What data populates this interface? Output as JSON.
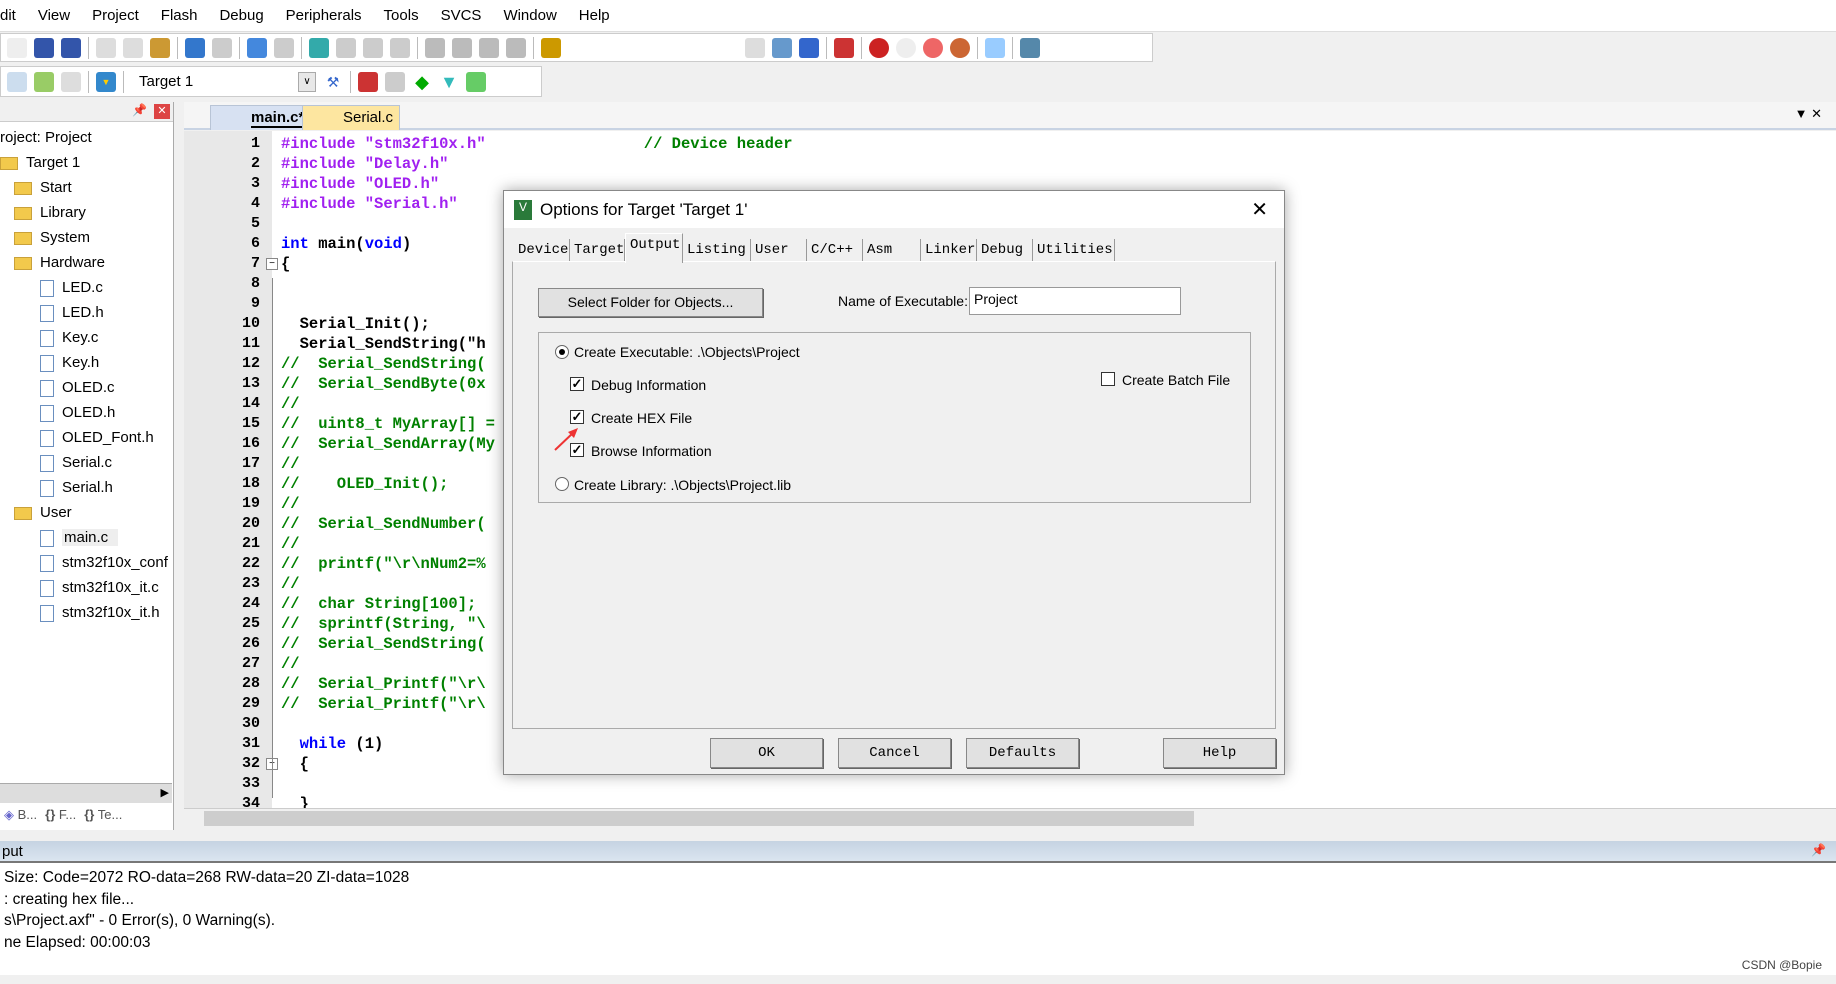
{
  "menu": [
    "dit",
    "View",
    "Project",
    "Flash",
    "Debug",
    "Peripherals",
    "Tools",
    "SVCS",
    "Window",
    "Help"
  ],
  "toolbar": {
    "target_select": "Target 1"
  },
  "file_tabs": [
    {
      "label": "main.c*",
      "active": true
    },
    {
      "label": "Serial.c",
      "active": false
    }
  ],
  "project_panel": {
    "items": [
      {
        "label": "roject: Project",
        "depth": 0,
        "icon": "none"
      },
      {
        "label": "Target 1",
        "depth": 0,
        "icon": "folder-open-icon"
      },
      {
        "label": "Start",
        "depth": 1,
        "icon": "folder-icon"
      },
      {
        "label": "Library",
        "depth": 1,
        "icon": "folder-icon"
      },
      {
        "label": "System",
        "depth": 1,
        "icon": "folder-icon"
      },
      {
        "label": "Hardware",
        "depth": 1,
        "icon": "folder-open-icon"
      },
      {
        "label": "LED.c",
        "depth": 2,
        "icon": "file-icon"
      },
      {
        "label": "LED.h",
        "depth": 2,
        "icon": "file-icon"
      },
      {
        "label": "Key.c",
        "depth": 2,
        "icon": "file-icon"
      },
      {
        "label": "Key.h",
        "depth": 2,
        "icon": "file-icon"
      },
      {
        "label": "OLED.c",
        "depth": 2,
        "icon": "file-icon"
      },
      {
        "label": "OLED.h",
        "depth": 2,
        "icon": "file-icon"
      },
      {
        "label": "OLED_Font.h",
        "depth": 2,
        "icon": "file-icon"
      },
      {
        "label": "Serial.c",
        "depth": 2,
        "icon": "file-icon"
      },
      {
        "label": "Serial.h",
        "depth": 2,
        "icon": "file-icon"
      },
      {
        "label": "User",
        "depth": 1,
        "icon": "folder-open-icon"
      },
      {
        "label": "main.c",
        "depth": 2,
        "icon": "file-icon",
        "selected": true
      },
      {
        "label": "stm32f10x_conf",
        "depth": 2,
        "icon": "file-icon"
      },
      {
        "label": "stm32f10x_it.c",
        "depth": 2,
        "icon": "file-icon"
      },
      {
        "label": "stm32f10x_it.h",
        "depth": 2,
        "icon": "file-icon"
      }
    ],
    "bottom_tabs": [
      "B...",
      "F...",
      "Te..."
    ]
  },
  "code_colors": {
    "pp": "#a020f0",
    "str": "#a020f0",
    "kw": "#0000ff",
    "cm": "#008000",
    "tx": "#000000"
  },
  "code": [
    [
      [
        "#include ",
        "pp"
      ],
      [
        "\"stm32f10x.h\"",
        "str"
      ],
      [
        "                 // Device header",
        "cm"
      ]
    ],
    [
      [
        "#include ",
        "pp"
      ],
      [
        "\"Delay.h\"",
        "str"
      ]
    ],
    [
      [
        "#include ",
        "pp"
      ],
      [
        "\"OLED.h\"",
        "str"
      ]
    ],
    [
      [
        "#include ",
        "pp"
      ],
      [
        "\"Serial.h\"",
        "str"
      ]
    ],
    [],
    [
      [
        "int",
        "kw"
      ],
      [
        " main(",
        "tx"
      ],
      [
        "void",
        "kw"
      ],
      [
        ")",
        "tx"
      ]
    ],
    [
      [
        "{",
        "tx"
      ]
    ],
    [],
    [],
    [
      [
        "  Serial_Init();",
        "tx"
      ]
    ],
    [
      [
        "  Serial_SendString(\"h",
        "tx"
      ]
    ],
    [
      [
        "//  Serial_SendString(",
        "cm"
      ]
    ],
    [
      [
        "//  Serial_SendByte(0x",
        "cm"
      ]
    ],
    [
      [
        "//",
        "cm"
      ]
    ],
    [
      [
        "//  uint8_t MyArray[] =",
        "cm"
      ]
    ],
    [
      [
        "//  Serial_SendArray(My",
        "cm"
      ]
    ],
    [
      [
        "//",
        "cm"
      ]
    ],
    [
      [
        "//    OLED_Init();",
        "cm"
      ]
    ],
    [
      [
        "//",
        "cm"
      ]
    ],
    [
      [
        "//  Serial_SendNumber(",
        "cm"
      ]
    ],
    [
      [
        "//",
        "cm"
      ]
    ],
    [
      [
        "//  printf(\"\\r\\nNum2=%",
        "cm"
      ]
    ],
    [
      [
        "//",
        "cm"
      ]
    ],
    [
      [
        "//  char String[100];",
        "cm"
      ]
    ],
    [
      [
        "//  sprintf(String, \"\\",
        "cm"
      ]
    ],
    [
      [
        "//  Serial_SendString(",
        "cm"
      ]
    ],
    [
      [
        "//",
        "cm"
      ]
    ],
    [
      [
        "//  Serial_Printf(\"\\r\\",
        "cm"
      ]
    ],
    [
      [
        "//  Serial_Printf(\"\\r\\",
        "cm"
      ]
    ],
    [],
    [
      [
        "  while",
        "kw"
      ],
      [
        " (1)",
        "tx"
      ]
    ],
    [
      [
        "  {",
        "tx"
      ]
    ],
    [],
    [
      [
        "  }",
        "tx"
      ]
    ]
  ],
  "dialog": {
    "title": "Options for Target 'Target 1'",
    "tabs": [
      "Device",
      "Target",
      "Output",
      "Listing",
      "User",
      "C/C++",
      "Asm",
      "Linker",
      "Debug",
      "Utilities"
    ],
    "active_tab": "Output",
    "select_folder": "Select Folder for Objects...",
    "name_label": "Name of Executable:",
    "name_value": "Project",
    "create_exe": "Create Executable:  .\\Objects\\Project",
    "create_exe_selected": true,
    "debug_info": "Debug Information",
    "debug_info_checked": true,
    "create_hex": "Create HEX File",
    "create_hex_checked": true,
    "browse_info": "Browse Information",
    "browse_info_checked": true,
    "create_lib": "Create Library:  .\\Objects\\Project.lib",
    "create_lib_selected": false,
    "batch": "Create Batch File",
    "batch_checked": false,
    "ok": "OK",
    "cancel": "Cancel",
    "defaults": "Defaults",
    "help": "Help"
  },
  "output": {
    "title": "put",
    "lines": [
      "Size: Code=2072 RO-data=268 RW-data=20 ZI-data=1028",
      ": creating hex file...",
      "s\\Project.axf\" - 0 Error(s), 0 Warning(s).",
      "ne Elapsed:  00:00:03"
    ]
  },
  "watermark": "CSDN @Bopie"
}
